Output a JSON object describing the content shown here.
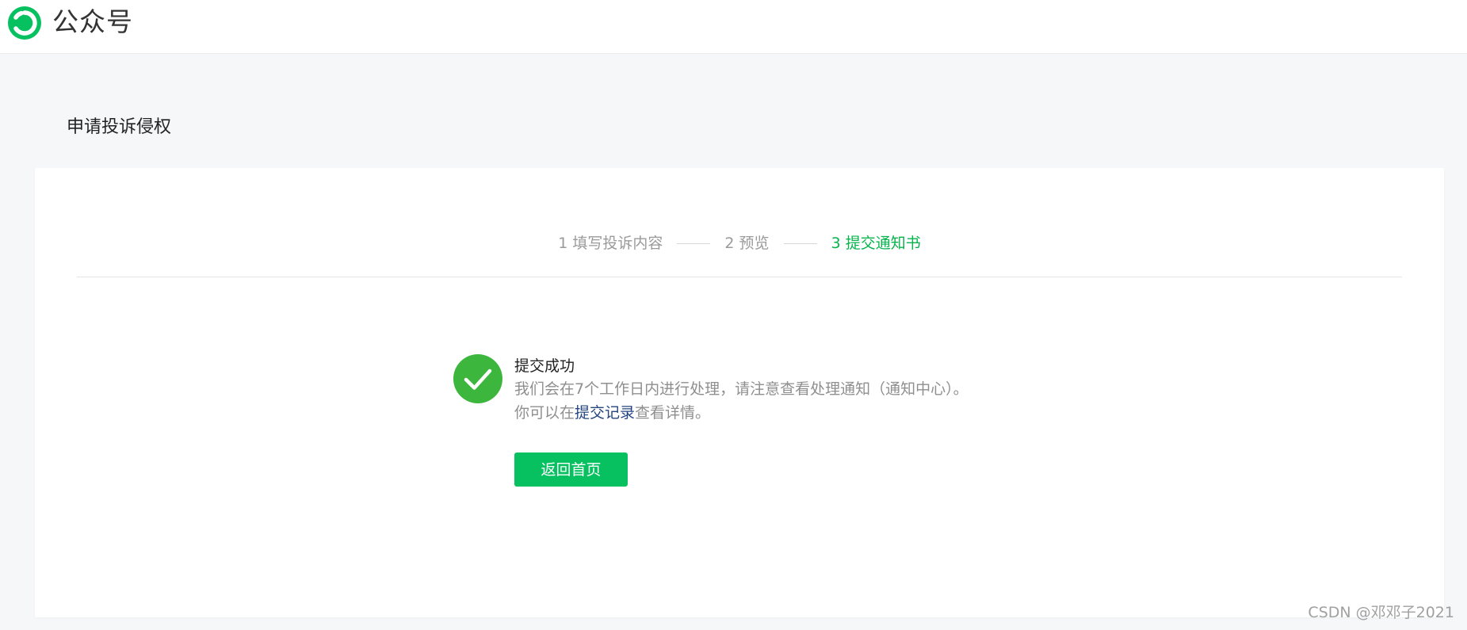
{
  "header": {
    "brand": "公众号",
    "logo_icon": "wechat-official-accounts-logo-icon",
    "logo_color": "#07c160"
  },
  "page": {
    "title": "申请投诉侵权"
  },
  "steps": [
    {
      "label": "1 填写投诉内容",
      "status": "done"
    },
    {
      "label": "2 预览",
      "status": "done"
    },
    {
      "label": "3 提交通知书",
      "status": "active"
    }
  ],
  "result": {
    "icon": "check-circle-icon",
    "icon_color": "#3cb63c",
    "title": "提交成功",
    "desc_line1": "我们会在7个工作日内进行处理，请注意查看处理通知（通知中心）。",
    "desc_line2_before": "你可以在",
    "desc_line2_link": "提交记录",
    "desc_line2_after": "查看详情。",
    "button_label": "返回首页",
    "button_color": "#07c160"
  },
  "watermark": "CSDN @邓邓子2021"
}
